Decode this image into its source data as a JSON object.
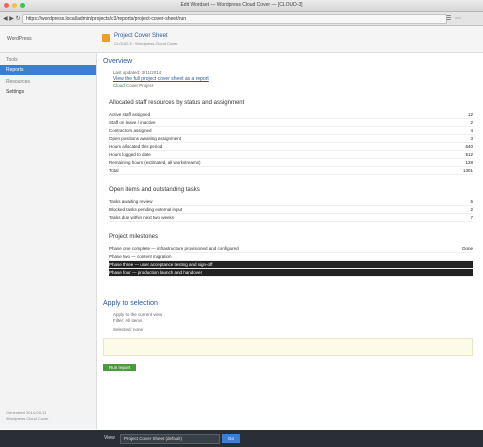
{
  "window": {
    "title": "Edit Wordset — Wordpress Cloud Cover — [CLOUD-3]",
    "url": "https://wordpress.local/admin/projects/c3/reports/project-cover-sheet/run"
  },
  "browser": {
    "nav_icons": "◀ ▶ ↻",
    "tool_icons": "☰ ⋯"
  },
  "header": {
    "brand": "WordPress",
    "project_name": "Project Cover Sheet",
    "project_sub": "CLOUD-3 · Wordpress Cloud Cover"
  },
  "sidebar": {
    "group1": "Tools",
    "items1": [
      "Reports"
    ],
    "group2": "Resources",
    "items2": [
      "Settings"
    ],
    "footer_line1": "Generated 2014-03-11",
    "footer_line2": "Wordpress Cloud Cover"
  },
  "main": {
    "title": "Overview",
    "meta_line": "Last updated: 3/11/2014",
    "link": "View the full project cover sheet as a report",
    "meta_line2": "Cloud Cover Project"
  },
  "sections": [
    {
      "title": "Allocated staff resources by status and assignment",
      "rows": [
        {
          "label": "Active staff assigned",
          "value": "12"
        },
        {
          "label": "Staff on leave / inactive",
          "value": "2"
        },
        {
          "label": "Contractors assigned",
          "value": "4"
        },
        {
          "label": "Open positions awaiting assignment",
          "value": "3"
        },
        {
          "label": "Hours allocated this period",
          "value": "640"
        },
        {
          "label": "Hours logged to date",
          "value": "512"
        },
        {
          "label": "Remaining hours (estimated, all workstreams)",
          "value": "128"
        },
        {
          "label": "Total",
          "value": "1301"
        }
      ]
    },
    {
      "title": "Open items and outstanding tasks",
      "rows": [
        {
          "label": "Tasks awaiting review",
          "value": "5"
        },
        {
          "label": "Blocked tasks pending external input",
          "value": "2"
        },
        {
          "label": "Tasks due within next two weeks",
          "value": "7"
        }
      ]
    },
    {
      "title": "Project milestones",
      "rows": [
        {
          "label": "Phase one complete — infrastructure provisioned and configured",
          "value": "Done"
        },
        {
          "label": "Phase two — content migration",
          "value": ""
        },
        {
          "label": "Phase three — user acceptance testing and sign-off",
          "value": ""
        },
        {
          "label": "Phase four — production launch and handover",
          "value": ""
        }
      ]
    }
  ],
  "query": {
    "title": "Apply to selection",
    "line1": "Apply to the current view",
    "line2": "Filter: All items",
    "line3": "Selected: none",
    "run_label": "Run report"
  },
  "statusbar": {
    "label": "View",
    "select_value": "Project Cover Sheet (default)",
    "button": "Go"
  },
  "colors": {
    "accent": "#3d7fcf",
    "brand": "#2a5a9e",
    "statusbar": "#2a2f36",
    "run": "#4c9a3c",
    "project_icon": "#f0a020"
  }
}
